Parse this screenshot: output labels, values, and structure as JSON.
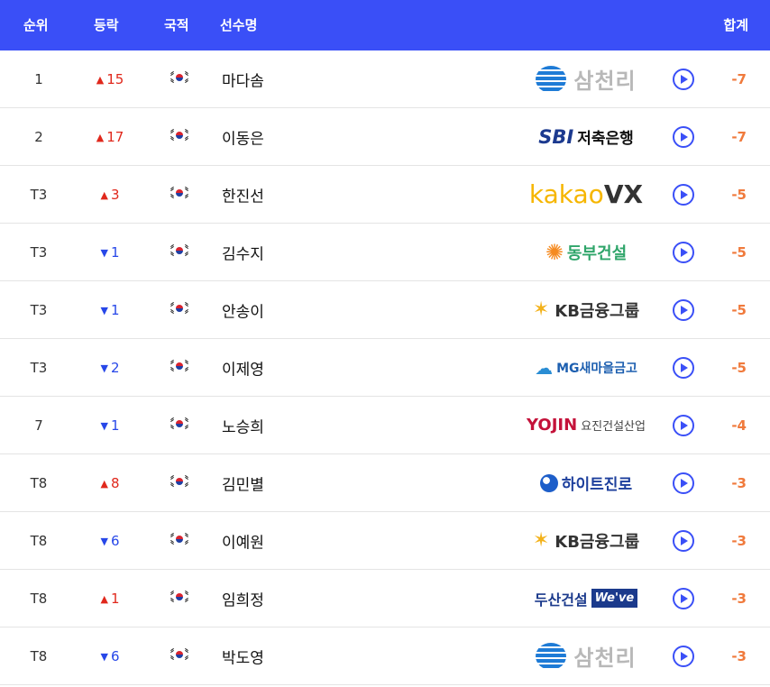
{
  "header": {
    "rank": "순위",
    "movement": "등락",
    "nationality": "국적",
    "player_name": "선수명",
    "total": "합계"
  },
  "rows": [
    {
      "rank": "1",
      "move_dir": "up",
      "move": "15",
      "name": "마다솜",
      "sponsor": "삼천리",
      "total": "-7"
    },
    {
      "rank": "2",
      "move_dir": "up",
      "move": "17",
      "name": "이동은",
      "sponsor": "SBI 저축은행",
      "total": "-7"
    },
    {
      "rank": "T3",
      "move_dir": "up",
      "move": "3",
      "name": "한진선",
      "sponsor": "kakaoVX",
      "total": "-5"
    },
    {
      "rank": "T3",
      "move_dir": "down",
      "move": "1",
      "name": "김수지",
      "sponsor": "동부건설",
      "total": "-5"
    },
    {
      "rank": "T3",
      "move_dir": "down",
      "move": "1",
      "name": "안송이",
      "sponsor": "KB금융그룹",
      "total": "-5"
    },
    {
      "rank": "T3",
      "move_dir": "down",
      "move": "2",
      "name": "이제영",
      "sponsor": "MG새마을금고",
      "total": "-5"
    },
    {
      "rank": "7",
      "move_dir": "down",
      "move": "1",
      "name": "노승희",
      "sponsor": "YOJIN 요진건설산업",
      "total": "-4"
    },
    {
      "rank": "T8",
      "move_dir": "up",
      "move": "8",
      "name": "김민별",
      "sponsor": "하이트진로",
      "total": "-3"
    },
    {
      "rank": "T8",
      "move_dir": "down",
      "move": "6",
      "name": "이예원",
      "sponsor": "KB금융그룹",
      "total": "-3"
    },
    {
      "rank": "T8",
      "move_dir": "up",
      "move": "1",
      "name": "임희정",
      "sponsor": "두산건설 We've",
      "total": "-3"
    },
    {
      "rank": "T8",
      "move_dir": "down",
      "move": "6",
      "name": "박도영",
      "sponsor": "삼천리",
      "total": "-3"
    }
  ],
  "colors": {
    "header_bg": "#3a4ff7",
    "up": "#e0281c",
    "down": "#2747e8",
    "total": "#f07a3c"
  },
  "icons": {
    "up_arrow": "▲",
    "down_arrow": "▼",
    "flag": "korea-flag-icon",
    "play": "play-icon"
  }
}
